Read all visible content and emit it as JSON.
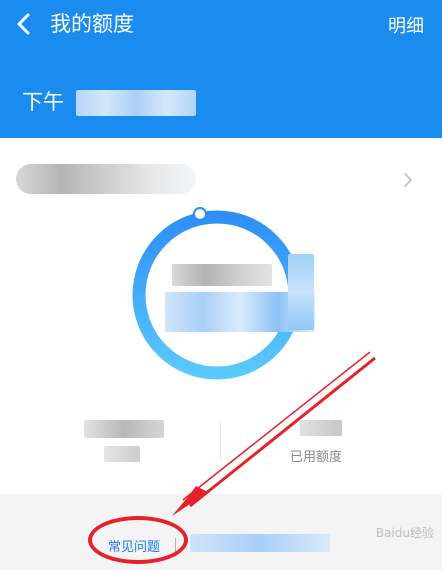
{
  "header": {
    "back_icon": "chevron-left-icon",
    "title": "我的额度",
    "detail_label": "明细",
    "greeting": "下午"
  },
  "stats": {
    "used_label": "已用额度"
  },
  "footer": {
    "faq_label": "常见问题"
  },
  "watermark": "Baidu经验",
  "colors": {
    "header_bg": "#1a8cf0",
    "ring_start": "#2f8ff5",
    "ring_end": "#5ac9ff",
    "annotation": "#e8202a",
    "link": "#1a7cf0"
  }
}
